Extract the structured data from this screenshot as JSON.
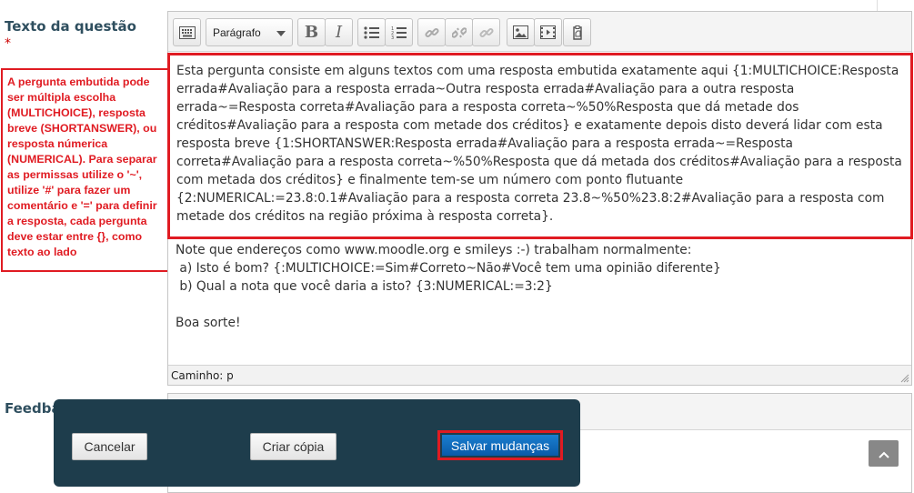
{
  "question_text": {
    "label": "Texto da questão",
    "required_marker": "*",
    "annotation": "A pergunta embutida pode ser múltipla escolha (MULTICHOICE), resposta breve (SHORTANSWER), ou resposta númerica (NUMERICAL). Para separar as permissas utilize o '~', utilize '#' para fazer um comentário e '=' para definir a resposta, cada pergunta deve estar entre {}, como texto ao lado"
  },
  "toolbar": {
    "format_select": "Parágrafo",
    "buttons": [
      {
        "icon": "toolbar-toggle-icon"
      },
      {
        "icon": "bold-icon",
        "label": "B"
      },
      {
        "icon": "italic-icon",
        "label": "I"
      },
      {
        "icon": "unordered-list-icon"
      },
      {
        "icon": "ordered-list-icon"
      },
      {
        "icon": "link-icon"
      },
      {
        "icon": "unlink-icon"
      },
      {
        "icon": "anchor-icon"
      },
      {
        "icon": "image-icon"
      },
      {
        "icon": "media-icon"
      },
      {
        "icon": "paste-icon"
      }
    ]
  },
  "editor": {
    "highlighted_text": "Esta pergunta consiste em alguns textos com uma resposta embutida exatamente aqui {1:MULTICHOICE:Resposta errada#Avaliação para a resposta errada~Outra resposta errada#Avaliação para a outra resposta errada~=Resposta correta#Avaliação para a resposta correta~%50%Resposta que dá metade dos créditos#Avaliação para a resposta com metade dos créditos} e exatamente depois disto deverá lidar com esta resposta breve {1:SHORTANSWER:Resposta errada#Avaliação para a resposta errada~=Resposta correta#Avaliação para a resposta correta~%50%Resposta que dá metada dos créditos#Avaliação para a resposta com metada dos créditos} e finalmente tem-se um número com ponto flutuante {2:NUMERICAL:=23.8:0.1#Avaliação para a resposta correta 23.8~%50%23.8:2#Avaliação para a resposta com metade dos créditos na região próxima à resposta correta}.",
    "line_note": "Note que endereços como www.moodle.org e smileys :-) trabalham normalmente:",
    "line_a": " a) Isto é bom? {:MULTICHOICE:=Sim#Correto~Não#Você tem uma opinião diferente}",
    "line_b": " b) Qual a nota que você daria a isto? {3:NUMERICAL:=3:2}",
    "line_end": "Boa sorte!",
    "status_path": "Caminho: p"
  },
  "feedback": {
    "label": "Feedba"
  },
  "actions": {
    "cancel": "Cancelar",
    "copy": "Criar cópia",
    "save": "Salvar mudanças"
  },
  "colors": {
    "highlight_red": "#e01b22",
    "panel_bg": "#1e3d4c",
    "primary_blue": "#0a5aa8",
    "label_color": "#2f4f5f"
  }
}
